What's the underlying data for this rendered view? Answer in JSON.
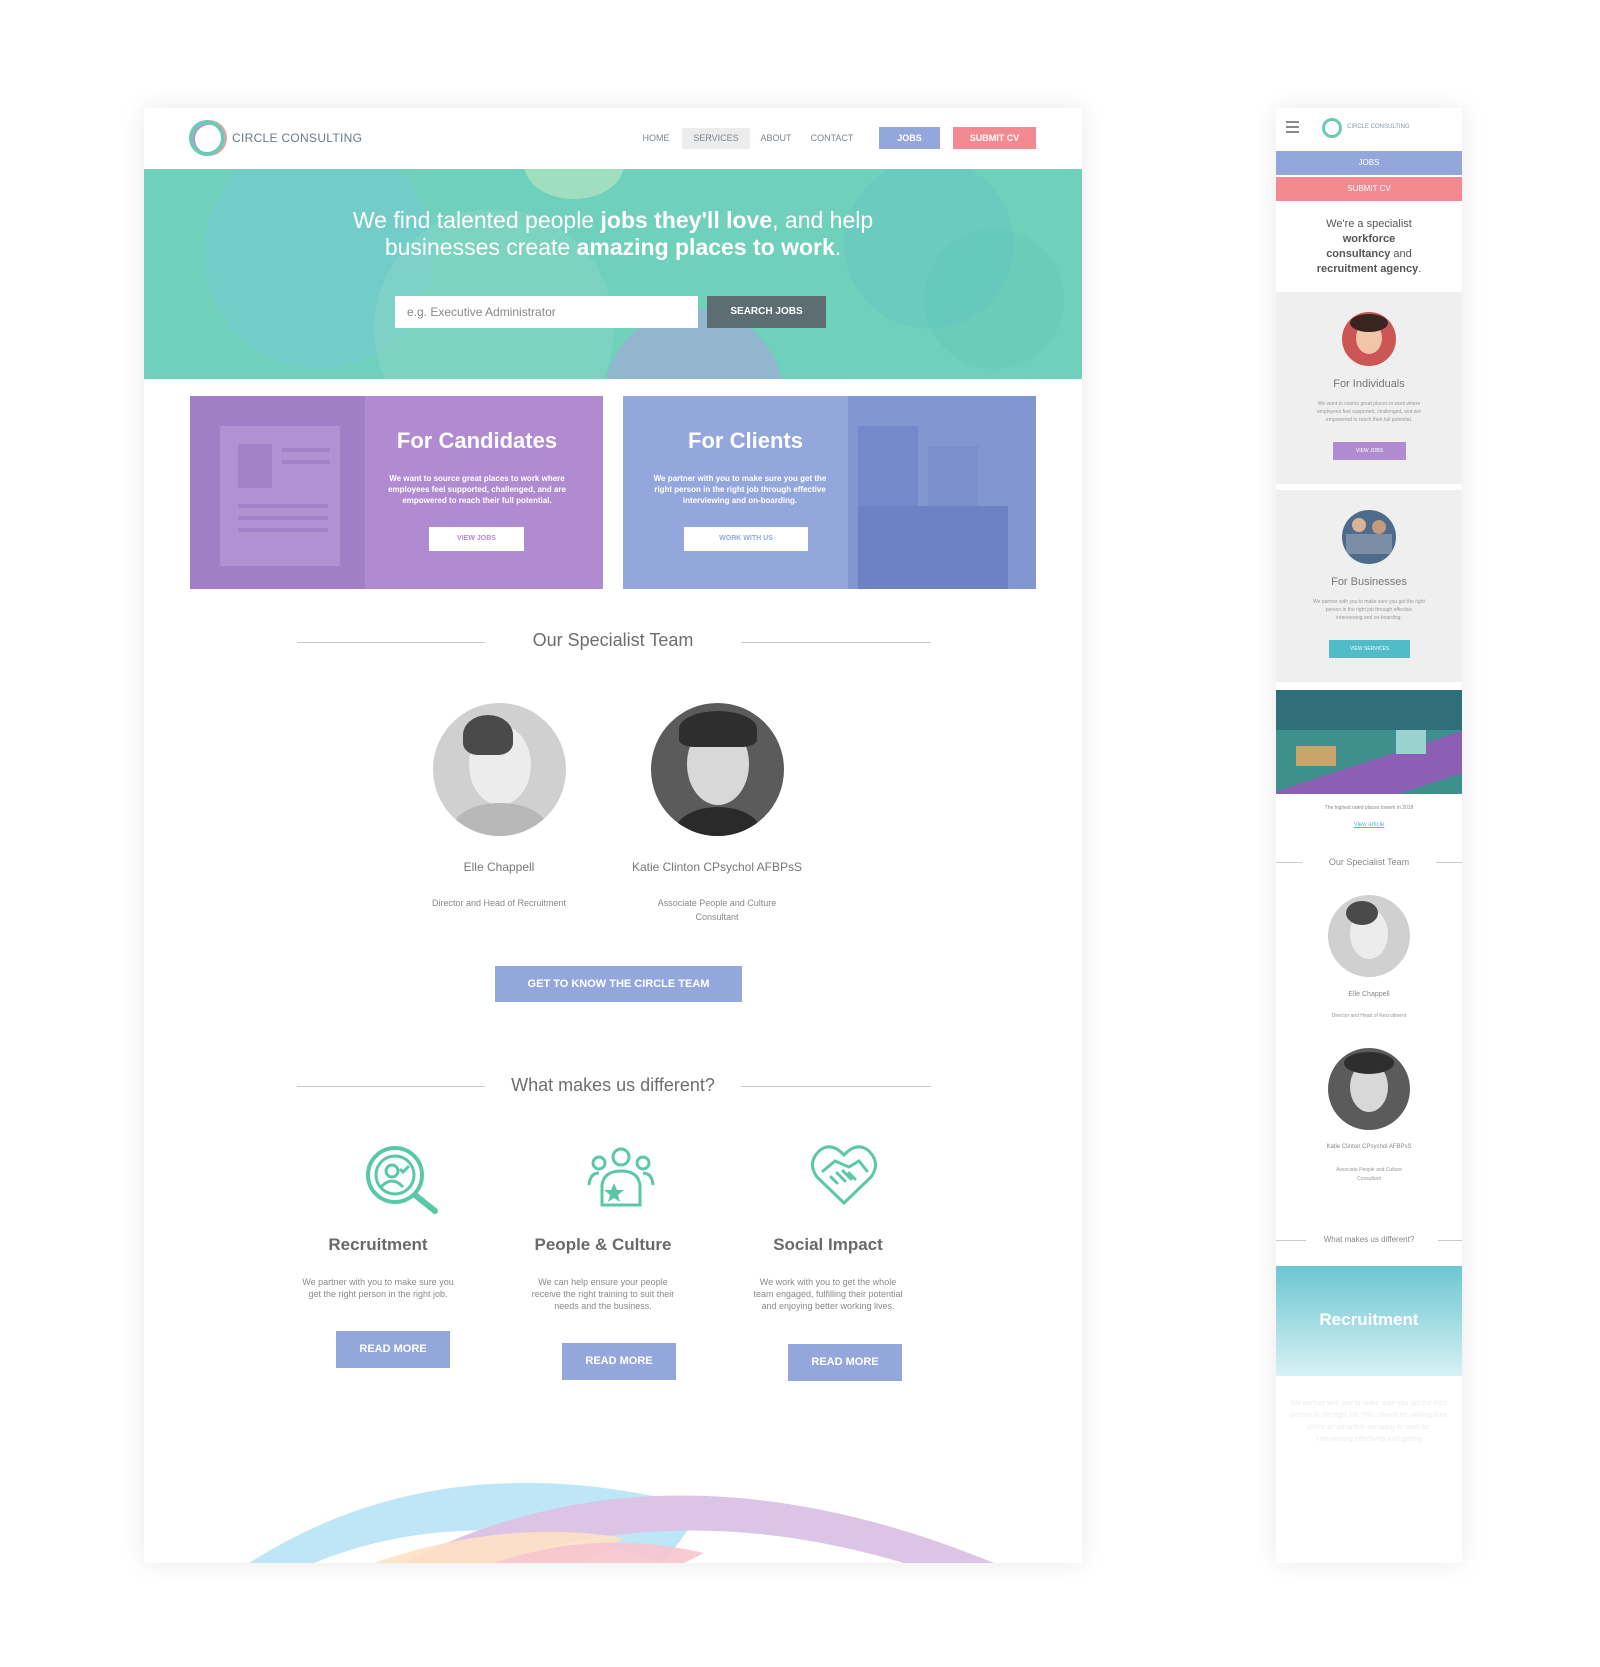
{
  "brand": {
    "name": "CIRCLE CONSULTING"
  },
  "nav": {
    "links": [
      "HOME",
      "SERVICES",
      "ABOUT",
      "CONTACT"
    ],
    "active": "SERVICES",
    "jobs_label": "JOBS",
    "submit_label": "SUBMIT CV"
  },
  "hero": {
    "line1_a": "We find talented people ",
    "line1_b": "jobs they'll love",
    "line1_c": ", and help",
    "line2_a": "businesses create ",
    "line2_b": "amazing places to work",
    "line2_c": ".",
    "search_placeholder": "e.g. Executive Administrator",
    "search_button": "SEARCH JOBS"
  },
  "cards": {
    "candidates": {
      "title": "For Candidates",
      "text": "We want to source great places to work where employees feel supported, challenged, and are empowered to reach their full potential.",
      "button": "VIEW JOBS"
    },
    "clients": {
      "title": "For Clients",
      "text": "We partner with you to make sure you get the right person in the right job through effective interviewing and on-boarding.",
      "button": "WORK WITH US"
    }
  },
  "team": {
    "title": "Our Specialist Team",
    "members": [
      {
        "name": "Elle Chappell",
        "role": "Director and Head of Recruitment"
      },
      {
        "name": "Katie Clinton CPsychol AFBPsS",
        "role_l1": "Associate People and Culture",
        "role_l2": "Consultant"
      }
    ],
    "button": "GET TO KNOW THE CIRCLE TEAM"
  },
  "different": {
    "title": "What makes us different?",
    "features": [
      {
        "title": "Recruitment",
        "l1": "We partner with you to make sure you",
        "l2": "get the right person in the right job.",
        "l3": "",
        "button": "READ MORE",
        "icon": "magnifier-person-icon"
      },
      {
        "title": "People & Culture",
        "l1": "We can help ensure your people",
        "l2": "receive the right training to suit their",
        "l3": "needs and the business.",
        "button": "READ MORE",
        "icon": "team-star-icon"
      },
      {
        "title": "Social Impact",
        "l1": "We work with you to get the whole",
        "l2": "team engaged, fulfilling their potential",
        "l3": "and enjoying better working lives.",
        "button": "READ MORE",
        "icon": "heart-handshake-icon"
      }
    ]
  },
  "mobile": {
    "brand": "CIRCLE CONSULTING",
    "jobs": "JOBS",
    "submit": "SUBMIT CV",
    "intro_a": "We're a specialist",
    "intro_b": "workforce",
    "intro_c1": "consultancy",
    "intro_c2": " and",
    "intro_d": "recruitment agency",
    "intro_e": ".",
    "individuals": {
      "title": "For Individuals",
      "l1": "We want to source great places to work where",
      "l2": "employees feel supported, challenged, and are",
      "l3": "empowered to reach their full potential.",
      "button": "VIEW JOBS"
    },
    "businesses": {
      "title": "For Businesses",
      "l1": "We partner with you to make sure you get the right",
      "l2": "person in the right job through effective",
      "l3": "interviewing and on-boarding.",
      "button": "VIEW SERVICES"
    },
    "article_caption": "The highest rated places towork in 2018",
    "article_link": "View article",
    "team_title": "Our Specialist Team",
    "members": [
      {
        "name": "Elle Chappell",
        "role": "Director and Head of Recruitment"
      },
      {
        "name": "Katie Clinton CPsychol AFBPsS",
        "role_l1": "Associate People and Culture",
        "role_l2": "Consultant"
      }
    ],
    "different_title": "What makes us different?",
    "recruitment_title": "Recruitment",
    "recruitment_text": "We partner with you to make sure you get the right person in the right job. This should be making sure you're an attractive company to work for, interviewing effectively and getting"
  },
  "colors": {
    "teal": "#6fd0bb",
    "lavender": "#b18bd1",
    "periwinkle": "#93a7dc",
    "coral": "#f48a91",
    "slate": "#5d6e73"
  }
}
